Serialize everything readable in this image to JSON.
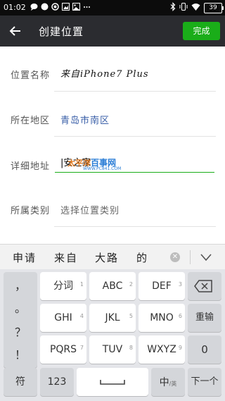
{
  "status_bar": {
    "time": "01:02",
    "battery": "39",
    "icons": [
      "chat-icon",
      "circle-icon",
      "record-icon",
      "picture-icon",
      "image-icon",
      "more-dots-icon"
    ],
    "right_icons": [
      "bluetooth-icon",
      "vibrate-icon",
      "wifi-icon",
      "battery-icon"
    ]
  },
  "app_bar": {
    "title": "创建位置",
    "done_label": "完成",
    "accent": "#1aad19"
  },
  "form": {
    "rows": [
      {
        "label": "位置名称",
        "value": "来自iPhone7 Plus"
      },
      {
        "label": "所在地区",
        "value": "青岛市南区"
      },
      {
        "label": "详细地址",
        "value": "|安之家"
      },
      {
        "label": "所属类别",
        "value": "选择位置类别"
      }
    ]
  },
  "watermark": {
    "brand_part1": "太平洋",
    "brand_part2": "百事网",
    "url": "WWW.PC841.COM"
  },
  "candidates": [
    "申请",
    "来自",
    "大路",
    "的"
  ],
  "keyboard": {
    "punctuation": [
      "，",
      "。",
      "？",
      "！"
    ],
    "row1": [
      {
        "label": "分词",
        "num": "1"
      },
      {
        "label": "ABC",
        "num": "2"
      },
      {
        "label": "DEF",
        "num": "3"
      }
    ],
    "row2": [
      {
        "label": "GHI",
        "num": "4"
      },
      {
        "label": "JKL",
        "num": "5"
      },
      {
        "label": "MNO",
        "num": "6"
      }
    ],
    "row3": [
      {
        "label": "PQRS",
        "num": "7"
      },
      {
        "label": "TUV",
        "num": "8"
      },
      {
        "label": "WXYZ",
        "num": "9"
      }
    ],
    "reenter": "重输",
    "zero": "0",
    "symbol": "符",
    "num123": "123",
    "lang_main": "中",
    "lang_sub": "/英",
    "next": "下一个"
  }
}
